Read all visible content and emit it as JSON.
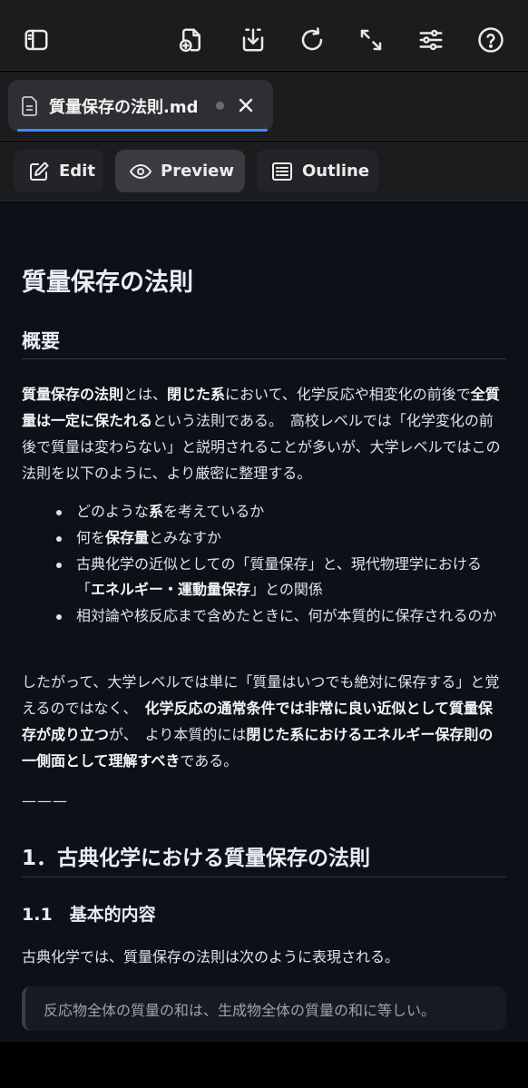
{
  "toolbar": {
    "icons": [
      "sidebar-icon",
      "new-file-icon",
      "download-icon",
      "refresh-icon",
      "expand-icon",
      "settings-sliders-icon",
      "help-icon"
    ]
  },
  "tab": {
    "title": "質量保存の法則.md",
    "unsaved_dot": true
  },
  "modes": {
    "edit": "Edit",
    "preview": "Preview",
    "outline": "Outline",
    "active": "preview"
  },
  "doc": {
    "h1": "質量保存の法則",
    "h2_overview": "概要",
    "p1": {
      "b1": "質量保存の法則",
      "t1": "とは、",
      "b2": "閉じた系",
      "t2": "において、化学反応や相変化の前後で",
      "b3": "全質量は一定に保たれる",
      "t3": "という法則である。　高校レベルでは「化学変化の前後で質量は変わらない」と説明されることが多いが、大学レベルではこの法則を以下のように、より厳密に整理する。"
    },
    "list": {
      "i1_a": "どのような",
      "i1_b": "系",
      "i1_c": "を考えているか",
      "i2_a": "何を",
      "i2_b": "保存量",
      "i2_c": "とみなすか",
      "i3_a": "古典化学の近似としての「質量保存」と、現代物理学における「",
      "i3_b": "エネルギー・運動量保存",
      "i3_c": "」との関係",
      "i4": "相対論や核反応まで含めたときに、何が本質的に保存されるのか"
    },
    "p2": {
      "t1": "したがって、大学レベルでは単に「質量はいつでも絶対に保存する」と覚えるのではなく、　",
      "b1": "化学反応の通常条件では非常に良い近似として質量保存が成り立つ",
      "t2": "が、　より本質的には",
      "b2": "閉じた系におけるエネルギー保存則の一側面として理解すべき",
      "t3": "である。"
    },
    "separator": "———",
    "h2_section1": "1．古典化学における質量保存の法則",
    "h3_1_1": "1.1　基本的内容",
    "p3": "古典化学では、質量保存の法則は次のように表現される。",
    "quote": "反応物全体の質量の和は、生成物全体の質量の和に等しい。"
  },
  "colors": {
    "accent": "#3d8bfd",
    "bg_content": "#0d1117",
    "bg_chrome": "#1b1c1e"
  }
}
